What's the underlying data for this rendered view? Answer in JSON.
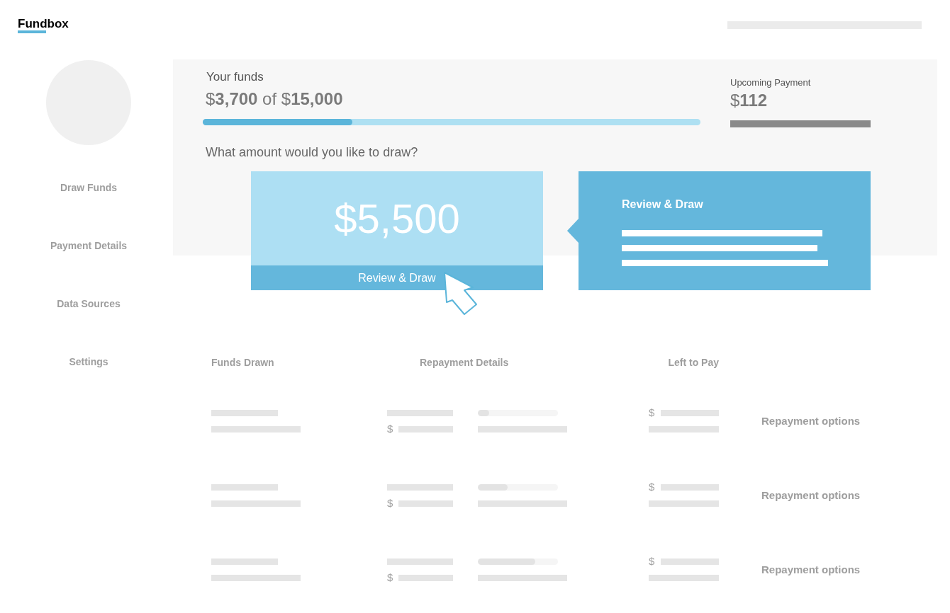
{
  "header": {
    "logo": "Fundbox"
  },
  "sidebar": {
    "nav_items": [
      "Draw Funds",
      "Payment Details",
      "Data Sources",
      "Settings"
    ]
  },
  "funds": {
    "label": "Your funds",
    "amount": "$**3,700** of $**15,000**",
    "level": 0.3,
    "question": "What amount would you like to draw?"
  },
  "upcoming_payment": {
    "label": "Upcoming Payment",
    "amount": "$**112**"
  },
  "draw_card": {
    "amount": "$5,500",
    "button": "Review & Draw"
  },
  "review_popover": {
    "title": "Review & Draw"
  },
  "table": {
    "columns": [
      "Funds Drawn",
      "Repayment Details",
      "Left to Pay"
    ],
    "rows": [
      {
        "repayment_symbol": "$",
        "progress": {
          "level": 0.14
        },
        "left_to_pay_symbol": "$",
        "action": "Repayment options"
      },
      {
        "repayment_symbol": "$",
        "progress": {
          "level": 0.37
        },
        "left_to_pay_symbol": "$",
        "action": "Repayment options"
      },
      {
        "repayment_symbol": "$",
        "progress": {
          "level": 0.72
        },
        "left_to_pay_symbol": "$",
        "action": "Repayment options"
      }
    ]
  }
}
